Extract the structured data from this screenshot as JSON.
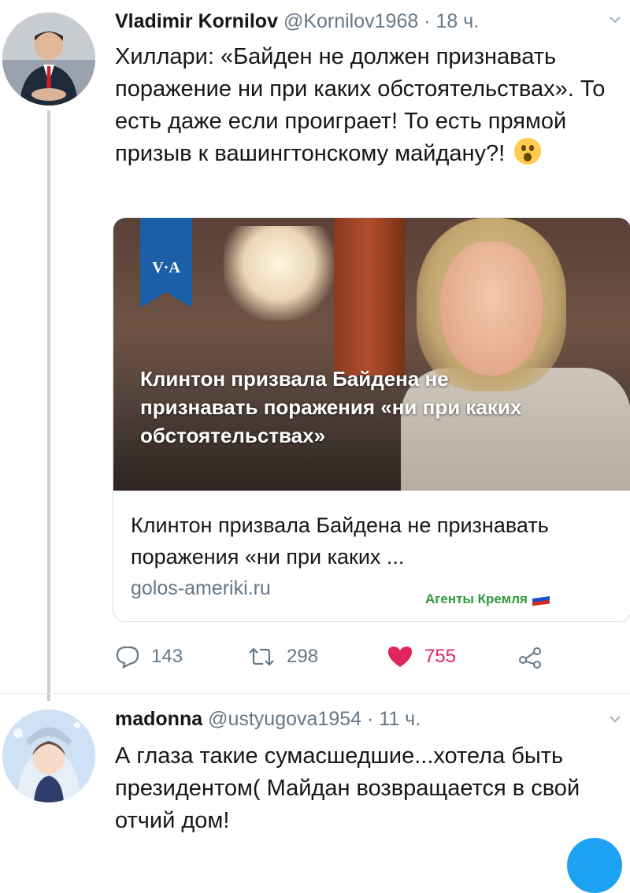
{
  "tweet1": {
    "name": "Vladimir Kornilov",
    "handle": "@Kornilov1968",
    "dot": "·",
    "time": "18 ч.",
    "text": "Хиллари: «Байден не должен признавать поражение ни при каких обстоятельствах». То есть даже если проиграет! То есть прямой призыв к вашингтонскому майдану?!",
    "emoji": "astonished-face",
    "card": {
      "logo_text": "V·A",
      "overlay_headline": "Клинтон призвала Байдена не признавать поражения «ни при каких обстоятельствах»",
      "title": "Клинтон призвала Байдена не признавать поражения «ни при каких ...",
      "domain": "golos-ameriki.ru"
    },
    "actions": {
      "replies": "143",
      "retweets": "298",
      "likes": "755"
    }
  },
  "watermark": "Агенты Кремля",
  "tweet2": {
    "name": "madonna",
    "handle": "@ustyugova1954",
    "dot": "·",
    "time": "11 ч.",
    "text": "А глаза такие сумасшедшие...хотела быть президентом( Майдан возвращается в свой отчий дом!"
  },
  "colors": {
    "like": "#e0245e",
    "muted": "#657786",
    "accent": "#1da1f2",
    "voa_blue": "#1b5fa8"
  }
}
